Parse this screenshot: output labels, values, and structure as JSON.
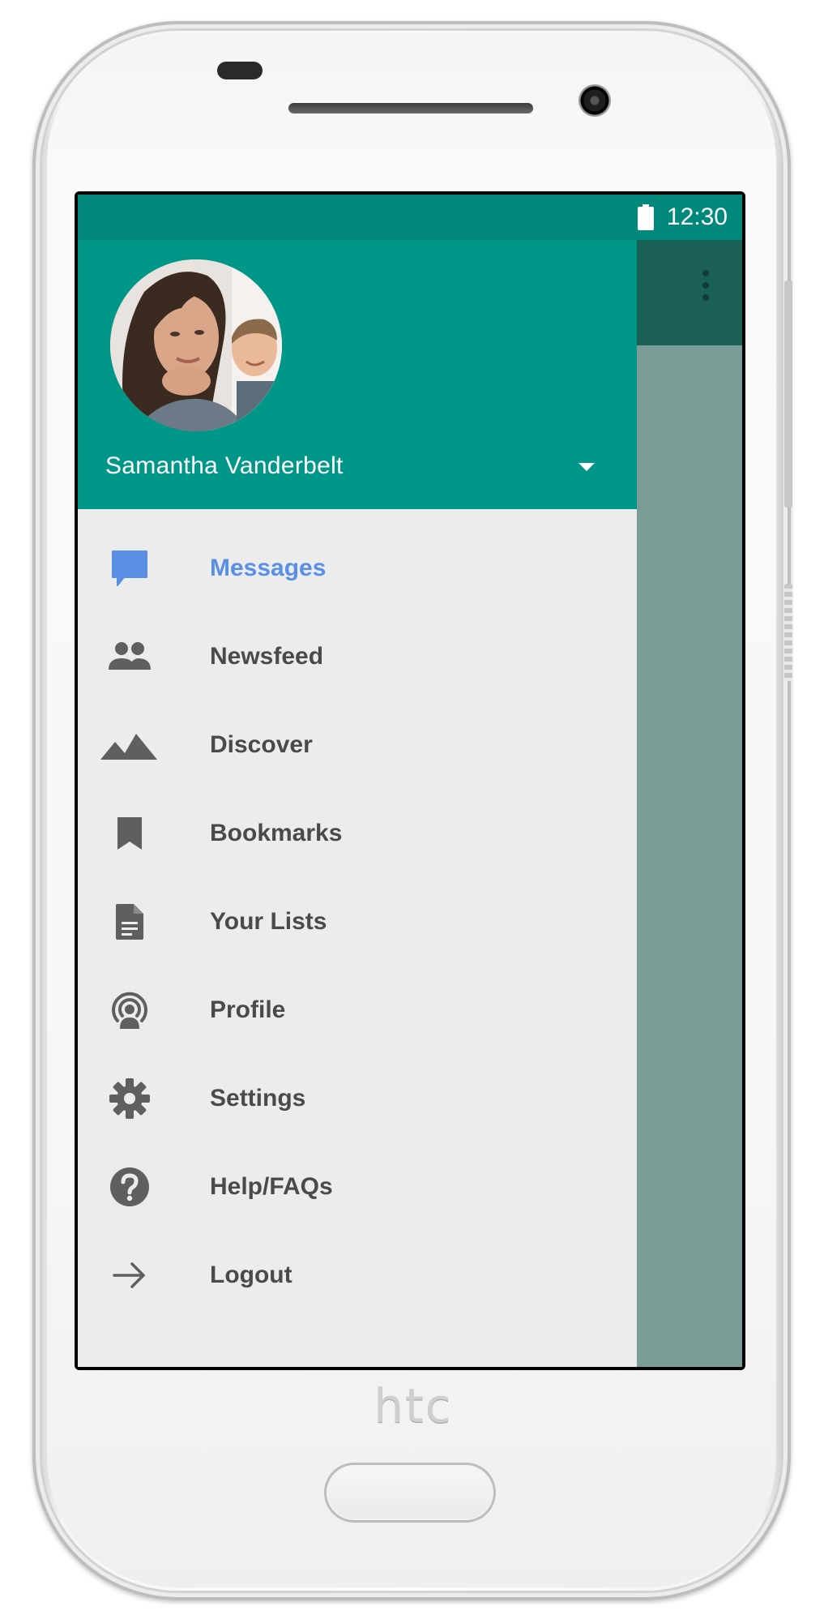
{
  "device": {
    "brand_logo": "htc"
  },
  "status_bar": {
    "time": "12:30",
    "icons": [
      "wifi-icon",
      "cellular-signal-icon",
      "battery-icon"
    ]
  },
  "app_toolbar": {
    "overflow_icon": "more-vert-icon"
  },
  "drawer": {
    "account_name": "Samantha Vanderbelt",
    "dropdown_icon": "arrow-drop-down-icon",
    "active_color": "#5a8fe6",
    "header_color": "#009688",
    "items": [
      {
        "label": "Messages",
        "icon": "message-icon",
        "active": true
      },
      {
        "label": "Newsfeed",
        "icon": "people-icon",
        "active": false
      },
      {
        "label": "Discover",
        "icon": "landscape-icon",
        "active": false
      },
      {
        "label": "Bookmarks",
        "icon": "bookmark-icon",
        "active": false
      },
      {
        "label": "Your Lists",
        "icon": "document-icon",
        "active": false
      },
      {
        "label": "Profile",
        "icon": "podcast-icon",
        "active": false
      },
      {
        "label": "Settings",
        "icon": "gear-icon",
        "active": false
      },
      {
        "label": "Help/FAQs",
        "icon": "help-icon",
        "active": false
      },
      {
        "label": "Logout",
        "icon": "arrow-forward-icon",
        "active": false
      }
    ]
  }
}
